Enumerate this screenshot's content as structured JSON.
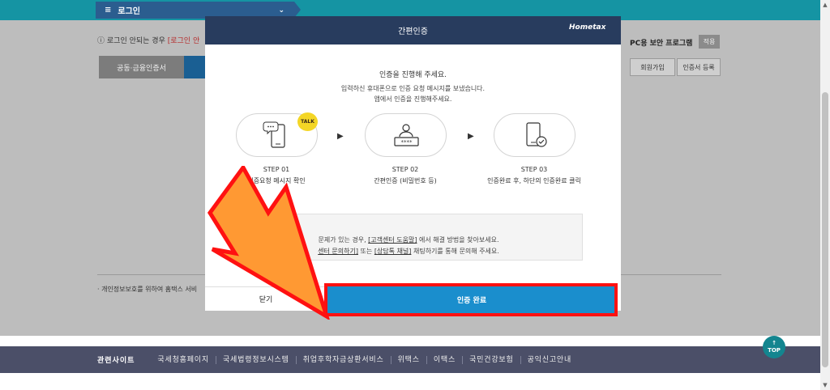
{
  "nav": {
    "menu_label": "로그인",
    "menu_icon": "hamburger-icon"
  },
  "page": {
    "warning_text": "로그인 안되는 경우",
    "warning_link": "[로그인 안",
    "tabs": [
      "공동·금융인증서"
    ],
    "pc_security_label": "PC용 보안 프로그램",
    "pc_security_button": "적용",
    "side_buttons": [
      "회원가입",
      "인증서 등록"
    ],
    "privacy_text": "· 개인정보보호를 위하여 홈택스 서비"
  },
  "modal": {
    "title": "간편인증",
    "logo": "Hometax",
    "heading": "인증을 진행해 주세요.",
    "sub_line1": "입력하신 휴대폰으로 인증 요청 메시지를 보냈습니다.",
    "sub_line2": "앱에서 인증을 진행해주세요.",
    "talk_badge": "TALK",
    "steps": [
      {
        "step": "STEP 01",
        "desc": "인증요청 메시지 확인"
      },
      {
        "step": "STEP 02",
        "desc": "간편인증 (비밀번호 등)"
      },
      {
        "step": "STEP 03",
        "desc": "인증완료 후, 하단의 인증완료 클릭"
      }
    ],
    "notice_line1_pre": "문제가 있는 경우,",
    "notice_link1": "[고객센터 도움말]",
    "notice_line1_post": "에서 해결 방법을 찾아보세요.",
    "notice_link2": "센터 문의하기]",
    "notice_mid": "또는",
    "notice_link3": "[상담톡 채널]",
    "notice_line2_post": "채팅하기를 통해 문의해 주세요.",
    "close_label": "닫기",
    "confirm_label": "인증 완료"
  },
  "footer": {
    "title": "관련사이트",
    "links": [
      "국세청홈페이지",
      "국세법령정보시스템",
      "취업후학자금상환서비스",
      "위택스",
      "이택스",
      "국민건강보험",
      "공익신고안내"
    ],
    "top_button": "TOP"
  },
  "colors": {
    "topbar": "#1594a3",
    "modal_header": "#283c5e",
    "confirm": "#1a8ecd",
    "highlight": "#ff1111",
    "arrow": "#ff9933"
  }
}
